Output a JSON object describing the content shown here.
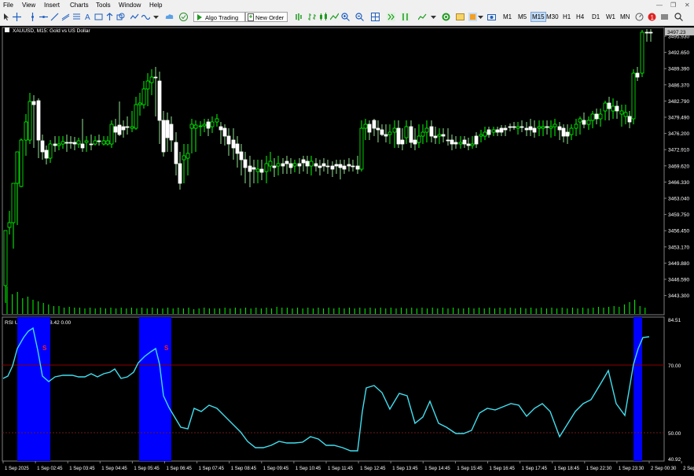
{
  "menu": [
    "File",
    "View",
    "Insert",
    "Charts",
    "Tools",
    "Window",
    "Help"
  ],
  "toolbar": {
    "algo_trading": "Algo Trading",
    "new_order": "New Order"
  },
  "timeframes": [
    "M1",
    "M5",
    "M15",
    "M30",
    "H1",
    "H4",
    "D1",
    "W1",
    "MN"
  ],
  "active_timeframe": "M15",
  "chart": {
    "title": "XAUUSD, M15:  Gold vs US Dollar",
    "current_price": "3497.23",
    "price_ticks": [
      "3495.930",
      "3492.650",
      "3489.390",
      "3486.370",
      "3482.790",
      "3479.490",
      "3476.200",
      "3472.910",
      "3469.620",
      "3466.330",
      "3463.040",
      "3459.750",
      "3456.450",
      "3453.170",
      "3449.880",
      "3446.590",
      "3443.300"
    ],
    "colors": {
      "up": "#00ff00",
      "down": "#ffffff",
      "rsi": "#40e0f0",
      "zone": "#0000ff",
      "level_high": "#8b0000",
      "level_low": "#6b1a1a",
      "signal": "#ff2020"
    }
  },
  "indicator": {
    "label": "RSI Ultimate MTF 78.42 0.00",
    "top_value": "84.51",
    "levels": [
      "70.00",
      "50.00"
    ],
    "bottom_value": "40.92",
    "signal_letter": "S"
  },
  "time_labels": [
    "1 Sep 2025",
    "1 Sep 02:45",
    "1 Sep 03:45",
    "1 Sep 04:45",
    "1 Sep 05:45",
    "1 Sep 06:45",
    "1 Sep 07:45",
    "1 Sep 08:45",
    "1 Sep 09:45",
    "1 Sep 10:45",
    "1 Sep 11:45",
    "1 Sep 12:45",
    "1 Sep 13:45",
    "1 Sep 14:45",
    "1 Sep 15:45",
    "1 Sep 16:45",
    "1 Sep 17:45",
    "1 Sep 18:45",
    "1 Sep 22:30",
    "1 Sep 23:30",
    "2 Sep 00:30",
    "2 Sep 01:30"
  ]
}
